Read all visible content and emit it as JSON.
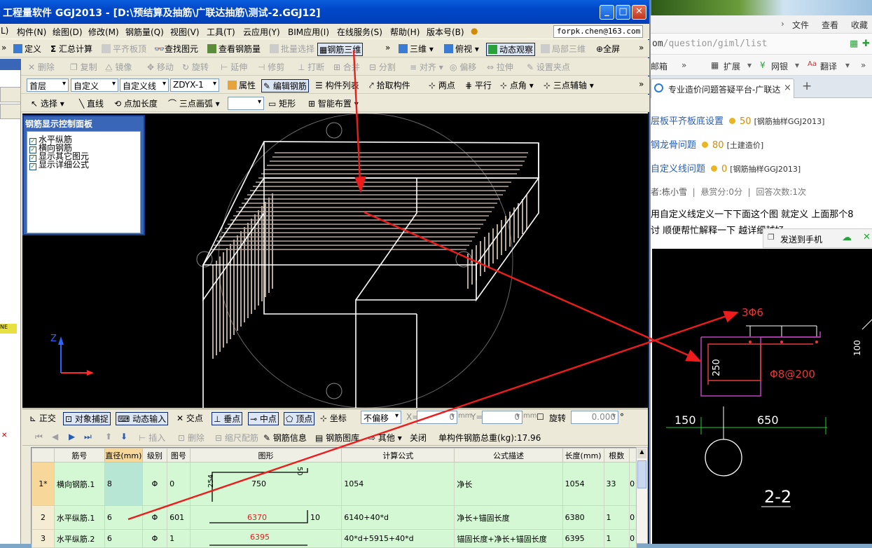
{
  "app": {
    "title": "工程量软件 GGJ2013 - [D:\\预结算及抽筋\\广联达抽筋\\测试-2.GGJ12]",
    "menu": [
      "L)",
      "构件(N)",
      "绘图(D)",
      "修改(M)",
      "钢筋量(Q)",
      "视图(V)",
      "工具(T)",
      "云应用(Y)",
      "BIM应用(I)",
      "在线服务(S)",
      "帮助(H)",
      "版本号(B)"
    ],
    "account": "forpk.chen@163.com",
    "toolbar1": [
      "定义",
      "汇总计算",
      "平齐板顶",
      "查找图元",
      "查看钢筋量",
      "批量选择",
      "钢筋三维",
      "三维",
      "俯视",
      "动态观察",
      "局部三维",
      "全屏"
    ],
    "toolbar2": [
      "删除",
      "复制",
      "镜像",
      "移动",
      "旋转",
      "延伸",
      "修剪",
      "打断",
      "合并",
      "分割",
      "对齐",
      "偏移",
      "拉伸",
      "设置夹点"
    ],
    "toolbar3": {
      "floor": "首层",
      "def": "自定义",
      "defline": "自定义线",
      "code": "ZDYX-1",
      "items": [
        "属性",
        "编辑钢筋",
        "构件列表",
        "拾取构件",
        "两点",
        "平行",
        "点角",
        "三点辅轴"
      ]
    },
    "toolbar4": [
      "选择",
      "直线",
      "点加长度",
      "三点画弧",
      "矩形",
      "智能布置"
    ],
    "panel": {
      "title": "钢筋显示控制面板",
      "items": [
        "水平纵筋",
        "横向钢筋",
        "显示其它图元",
        "显示详细公式"
      ]
    },
    "axes": {
      "z": "Z"
    },
    "snapbar": {
      "items": [
        "正交",
        "对象捕捉",
        "动态输入",
        "交点",
        "垂点",
        "中点",
        "顶点",
        "坐标"
      ],
      "offset": "不偏移",
      "x_label": "X=",
      "x_val": "0",
      "y_label": "Y=",
      "y_val": "0",
      "unit": "mm",
      "rotate": "旋转",
      "rotate_val": "0.000",
      "deg": "°"
    },
    "rebar_bar": {
      "items": [
        "插入",
        "删除",
        "缩尺配筋",
        "钢筋信息",
        "钢筋图库",
        "其他",
        "关闭"
      ],
      "total": "单构件钢筋总重(kg):17.96"
    },
    "table": {
      "headers": [
        "",
        "筋号",
        "直径(mm)",
        "级别",
        "图号",
        "图形",
        "计算公式",
        "公式描述",
        "长度(mm)",
        "根数",
        ""
      ],
      "rows": [
        {
          "idx": "1*",
          "name": "横向钢筋.1",
          "dia": "8",
          "grade": "Φ",
          "fig": "0",
          "shape_main": "750",
          "shape_a": "254",
          "shape_b": "50",
          "formula": "1054",
          "desc": "净长",
          "len": "1054",
          "count": "33",
          "extra": "0"
        },
        {
          "idx": "2",
          "name": "水平纵筋.1",
          "dia": "6",
          "grade": "Φ",
          "fig": "601",
          "shape_main": "6370",
          "shape_a": "10",
          "formula": "6140+40*d",
          "desc": "净长+锚固长度",
          "len": "6380",
          "count": "1",
          "extra": "0"
        },
        {
          "idx": "3",
          "name": "水平纵筋.2",
          "dia": "6",
          "grade": "Φ",
          "fig": "1",
          "shape_main": "6395",
          "formula": "40*d+5915+40*d",
          "desc": "锚固长度+净长+锚固长度",
          "len": "6395",
          "count": "1",
          "extra": "0"
        }
      ]
    }
  },
  "browser": {
    "menu": [
      "文件",
      "查看",
      "收藏"
    ],
    "url_host": "om",
    "url_path": "/question/giml/list",
    "bookmarks": [
      "邮箱",
      "扩展",
      "网银",
      "翻译"
    ],
    "tab": "专业造价问题答疑平台-广联达",
    "questions": [
      {
        "title": "层板平齐板底设置",
        "points": "50",
        "tag": "[钢筋抽样GGJ2013]"
      },
      {
        "title": "钢龙骨问题",
        "points": "80",
        "tag": "[土建造价]"
      },
      {
        "title": "自定义线问题",
        "points": "0",
        "tag": "[钢筋抽样GGJ2013]"
      }
    ],
    "meta": {
      "author": "者:栋小雪",
      "reward": "悬赏分:0分",
      "answers": "回答次数:1次"
    },
    "body1": "用自定义线定义一下下面这个图 就定义 上面那个8",
    "body2": "讨 顺便帮忙解释一下 越详细越好",
    "send": "发送到手机",
    "drawing": {
      "rebar1": "3Φ6",
      "dim250": "250",
      "rebar2": "Φ8@200",
      "dim100": "100",
      "dim150": "150",
      "dim650": "650",
      "section": "2-2"
    }
  }
}
